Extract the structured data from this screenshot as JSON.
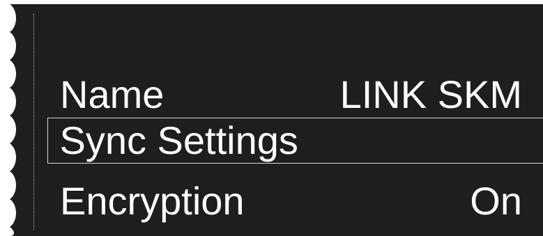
{
  "menu": {
    "items": [
      {
        "label": "Name",
        "value": "LINK SKM"
      },
      {
        "label": "Sync Settings",
        "value": ""
      },
      {
        "label": "Encryption",
        "value": "On"
      }
    ],
    "selected_index": 1
  },
  "colors": {
    "background": "#1e1e1e",
    "text": "#ffffff",
    "selection_border": "#d9d9d9"
  }
}
